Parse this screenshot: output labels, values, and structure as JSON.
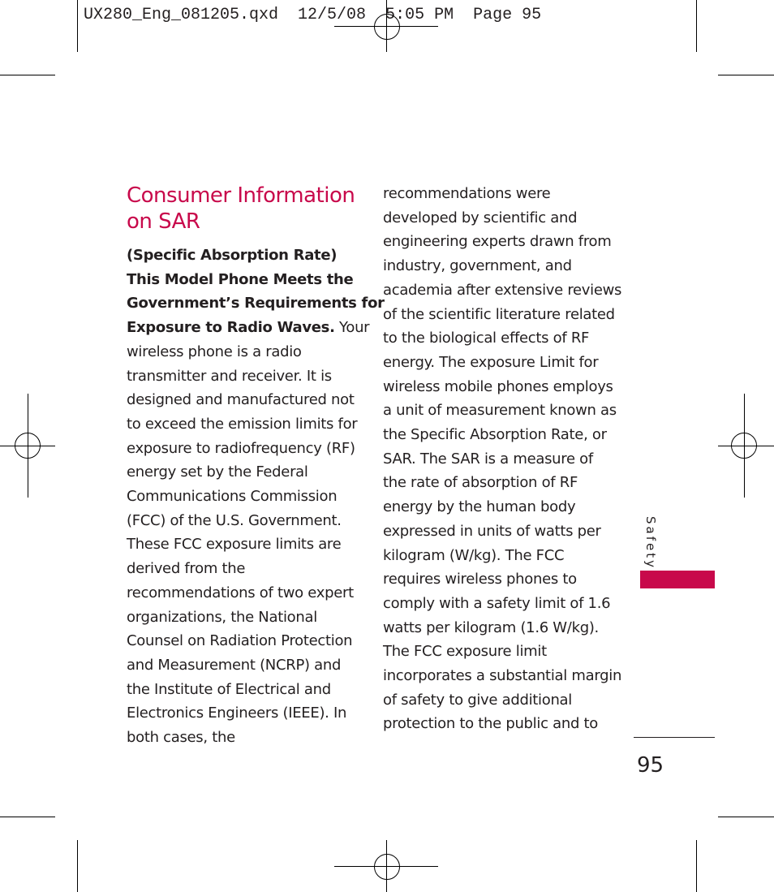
{
  "slug": "UX280_Eng_081205.qxd  12/5/08  5:05 PM  Page 95",
  "title_lines": [
    "Consumer Information",
    "on SAR"
  ],
  "column1": {
    "bold_lines": [
      "(Specific Absorption Rate)",
      "This Model Phone Meets the",
      "Government’s Requirements for",
      "Exposure to Radio Waves."
    ],
    "bold_tail": " Your",
    "lines": [
      "wireless phone is a radio",
      "transmitter and receiver. It is",
      "designed and manufactured not",
      "to exceed the emission limits for",
      "exposure to radiofrequency (RF)",
      "energy set by the Federal",
      "Communications Commission",
      "(FCC) of the U.S. Government.",
      "These FCC exposure limits are",
      "derived from the",
      "recommendations of two expert",
      "organizations, the National",
      "Counsel on Radiation Protection",
      "and Measurement (NCRP) and",
      "the Institute of Electrical and",
      "Electronics Engineers (IEEE). In",
      "both cases, the"
    ]
  },
  "column2": {
    "lines": [
      "recommendations were",
      "developed by scientific and",
      "engineering experts drawn from",
      "industry, government, and",
      "academia after extensive reviews",
      "of the scientific literature related",
      "to the biological effects of RF",
      "energy. The exposure Limit for",
      "wireless mobile phones employs",
      "a unit of measurement known as",
      "the Specific Absorption Rate, or",
      "SAR. The SAR is a measure of",
      "the rate of absorption of RF",
      "energy by the human body",
      "expressed in units of watts per",
      "kilogram (W/kg). The FCC",
      "requires wireless phones to",
      "comply with a safety limit of 1.6",
      "watts per kilogram (1.6 W/kg).",
      "The FCC exposure limit",
      "incorporates a substantial margin",
      "of safety to give additional",
      "protection to the public and to"
    ]
  },
  "section_tab": "Safety",
  "page_number": "95",
  "colors": {
    "accent": "#c8094b",
    "text": "#231f20"
  }
}
